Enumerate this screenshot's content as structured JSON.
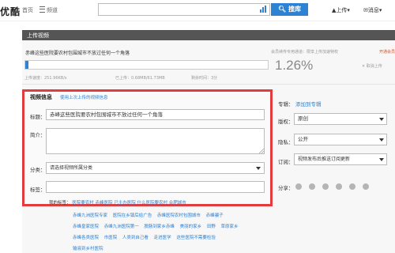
{
  "topbar": {
    "logo": "优酷",
    "home": "首页",
    "menu": "频道",
    "search_button": "搜库",
    "upload": "上传",
    "messages": "消息"
  },
  "panel": {
    "title": "上传视频",
    "file_name": "赤峰这些医院要农村包围城市不放过任何一个角落",
    "hint": "会员续传专用通道：限享上传加速特权",
    "vip_link": "开通会员",
    "percent": "1.26%",
    "progress": 0.0126,
    "cancel": "取消上传",
    "speed": "上传速度：251.96KB/s",
    "uploaded": "已上传：0.68MB/61.73MB",
    "remaining": "剩余时间：3分"
  },
  "form": {
    "info_title": "视频信息",
    "use_prev": "使用上次上传的视频信息",
    "title_label": "标题：",
    "title_value": "赤峰这些医院要农村包围城市不放过任何一个角落",
    "desc_label": "简介：",
    "category_label": "分类：",
    "category_value": "请选择视频所属分类",
    "tags_label": "标签："
  },
  "right": {
    "topic_label": "专辑：",
    "topic_link": "添加到专辑",
    "copyright_label": "版权：",
    "copyright_value": "原创",
    "privacy_label": "隐私：",
    "privacy_value": "公开",
    "subscribe_label": "订阅：",
    "subscribe_value": "视频发布后推送订阅更新",
    "share_label": "分享："
  },
  "tags": {
    "my_tags": "我的标签：",
    "suggest_row0": "医院要农村   赤峰医院   已主办医院   什么医院要农村   合肥城市",
    "row1": [
      "赤峰九洲医院专家",
      "医院在乡镇后给广告",
      "赤峰医院农村包围城市",
      "赤峰骗子"
    ],
    "row2": [
      "赤峰皇家医院",
      "赤峰九洲医院第一",
      "脱肠到家乡赤峰",
      "美丽的家乡",
      "田野",
      "草原家乡"
    ],
    "row3": [
      "赤峰各类医院",
      "市医院",
      "人类到自己看",
      "走进医学",
      "这些医院不需要检验"
    ],
    "row4": [
      "输液到乡村医院"
    ]
  }
}
